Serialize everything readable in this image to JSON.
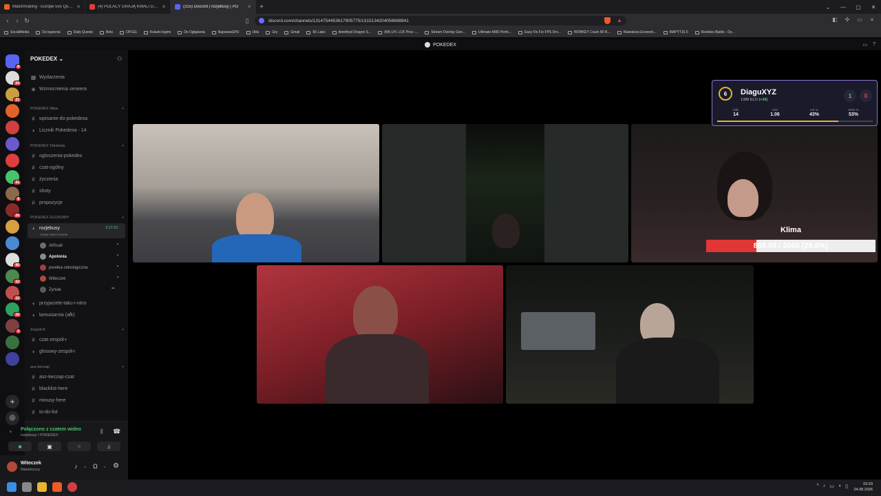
{
  "browser": {
    "tabs": [
      {
        "label": "Matchmaking - Europe 5v5 Queue",
        "color": "#e2622b"
      },
      {
        "label": "(4) POLACY GRAJĄ KWALI DO IEM C",
        "color": "#e03e3e"
      },
      {
        "label": "(315) Discord | rozjebusy | PO",
        "color": "#5865f2"
      }
    ],
    "url": "discord.com/channels/1314754453617905775/1315134204056698941",
    "bookmarks": [
      "SocialMedia",
      "Do kupienia",
      "Daily Quests",
      "Bets",
      "OP.GG",
      "Ksiazki legimi",
      "Do Oglądania",
      "NaprawaGPU",
      "Utils",
      "Gry",
      "Gmail",
      "6K Labs",
      "Amethyst Dragon S...",
      "(84) LPL LCK Pros -...",
      "Stream Overlay Gen...",
      "Ultimate AMD Perfo...",
      "Easy Fix For FPS Dro...",
      "WOBKEY Crush 80 R...",
      "Klawiatura Evowork...",
      "MAPYT16.5",
      "Redviles Builds - Dy..."
    ]
  },
  "discord": {
    "window_title": "POKEDEX",
    "server_name": "POKEDEX",
    "server_badges": [
      "8",
      "54",
      "21",
      "",
      "",
      "",
      "",
      "41",
      "8",
      "30",
      "",
      "",
      "86",
      "12",
      "12",
      "10",
      "3",
      "",
      ""
    ],
    "top_items": [
      "Wydarzenia",
      "Wzmocnienia serwera"
    ],
    "categories": [
      {
        "name": "POKEDEX Wpis",
        "channels": [
          "wpisanie-do-pokedexa",
          "Licznik Pokedexa - 14"
        ]
      },
      {
        "name": "POKEDEX Tekstowy",
        "channels": [
          "ogloszenia-pokedex",
          "czat-ogólny",
          "życzenia",
          "shoty",
          "propozycje"
        ]
      },
      {
        "name": "POKEDEX GLOSOWY",
        "channels": [
          "rozjebusy"
        ]
      },
      {
        "name": "Zespół R",
        "channels": [
          "czat-zespół-r",
          "glosowy-zespół-r"
        ]
      },
      {
        "name": "asz-keczap",
        "channels": [
          "asz-keczap-czat",
          "blacklist-here",
          "minusy-here",
          "to-do-list"
        ]
      }
    ],
    "active_voice": {
      "name": "rozjebusy",
      "timer": "3:21:53",
      "status": "Ustaw status kanału"
    },
    "voice_users": [
      "AllScall",
      "Apolonia",
      "perełka onkologiczna",
      "Witeczek",
      "Zyniak"
    ],
    "other_voice": [
      "przyjaciele-taku-i-nitro",
      "lamusiarnia (afk)"
    ],
    "connection": {
      "title": "Połączono z czatem wideo",
      "sub": "rozjebusy / POKEDEX"
    },
    "user": {
      "name": "Witeczek",
      "status": "Niewidoczny"
    }
  },
  "overlay": {
    "level": "6",
    "name": "DiaguXYZ",
    "elo": "1388 ELO",
    "elo_change": "(+28)",
    "wins": "1",
    "losses": "0",
    "stats": [
      {
        "label": "Kills",
        "value": "14"
      },
      {
        "label": "K/D",
        "value": "1.06"
      },
      {
        "label": "HS %",
        "value": "43%"
      },
      {
        "label": "Wins %",
        "value": "53%"
      }
    ],
    "progress": 0.78
  },
  "stream": {
    "cam_name": "Klima",
    "goal_text": "888.09 / 3000 (29.6%)",
    "goal_fraction": 0.296
  },
  "taskbar": {
    "time": "03:29",
    "date": "24.08.2026"
  }
}
